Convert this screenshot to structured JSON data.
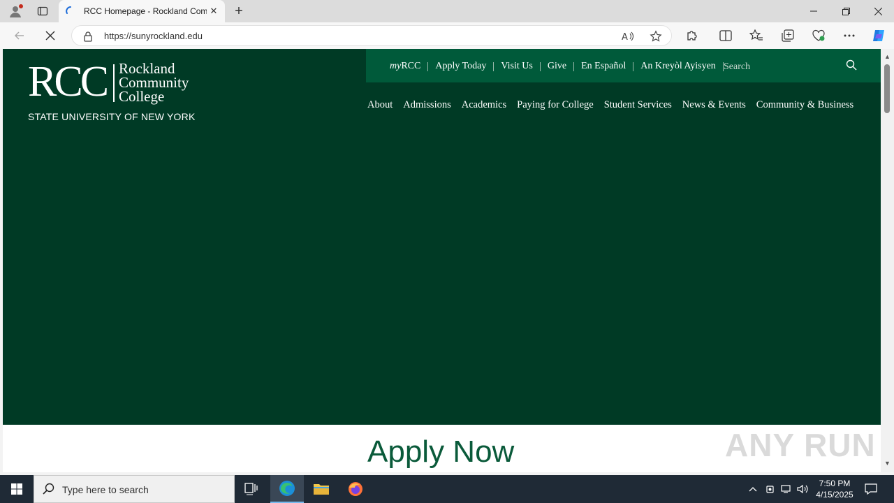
{
  "browser": {
    "tab_title": "RCC Homepage - Rockland Com",
    "url": "https://sunyrockland.edu",
    "window_controls": {
      "minimize": "—",
      "restore": "❐",
      "close": "✕"
    },
    "tab_close": "✕",
    "new_tab": "+"
  },
  "site": {
    "logo": {
      "initials": "RCC",
      "name_line1": "Rockland",
      "name_line2": "Community",
      "name_line3": "College",
      "tagline": "STATE UNIVERSITY OF NEW YORK"
    },
    "utility_nav": {
      "myrcc_prefix": "my",
      "myrcc_suffix": "RCC",
      "items": [
        "Apply Today",
        "Visit Us",
        "Give",
        "En Español",
        "An Kreyòl Ayisyen"
      ],
      "search_placeholder": "Search"
    },
    "main_nav": [
      "About",
      "Admissions",
      "Academics",
      "Paying for College",
      "Student Services",
      "News & Events",
      "Community & Business"
    ],
    "apply_heading": "Apply Now",
    "watermark": "ANY RUN"
  },
  "taskbar": {
    "search_placeholder": "Type here to search",
    "time": "7:50 PM",
    "date": "4/15/2025"
  },
  "colors": {
    "hero_bg": "#003a25",
    "utility_bg": "#005a3a",
    "apply_text": "#0a5a3a"
  }
}
